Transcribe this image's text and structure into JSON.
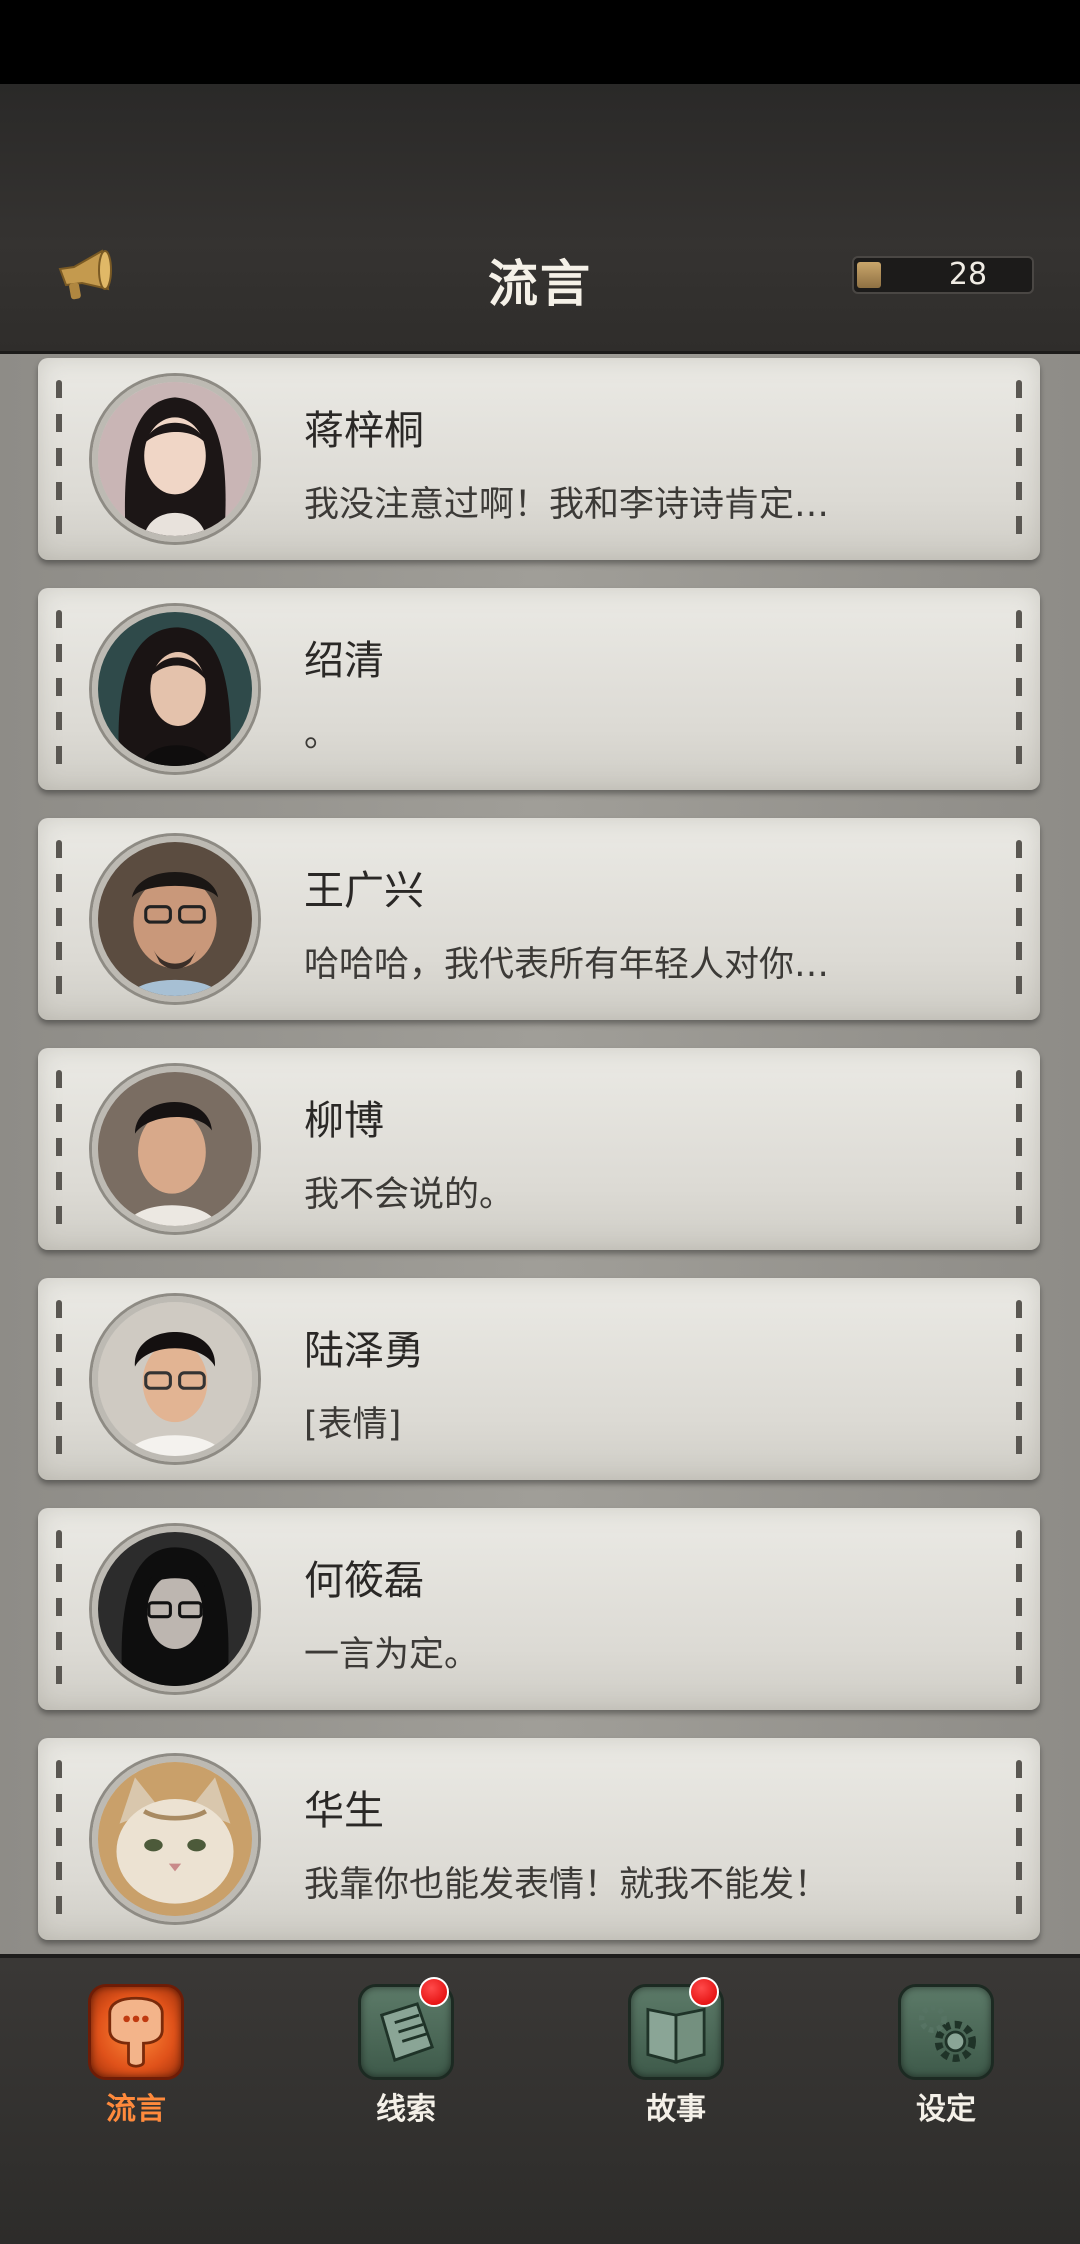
{
  "header": {
    "title": "流言",
    "counter_value": "28",
    "counter_fill_fraction": 0.14,
    "horn_icon": "megaphone-icon"
  },
  "contacts": [
    {
      "name": "蒋梓桐",
      "message": "我没注意过啊！我和李诗诗肯定…",
      "avatar": "female-long-hair-avatar"
    },
    {
      "name": "绍清",
      "message": "。",
      "avatar": "female-portrait-avatar"
    },
    {
      "name": "王广兴",
      "message": "哈哈哈，我代表所有年轻人对你…",
      "avatar": "male-glasses-beard-avatar"
    },
    {
      "name": "柳博",
      "message": "我不会说的。",
      "avatar": "male-short-hair-avatar"
    },
    {
      "name": "陆泽勇",
      "message": "[表情]",
      "avatar": "male-glasses-avatar"
    },
    {
      "name": "何筱磊",
      "message": "一言为定。",
      "avatar": "male-long-hair-glasses-avatar"
    },
    {
      "name": "华生",
      "message": "我靠你也能发表情！就我不能发！",
      "avatar": "cat-avatar"
    }
  ],
  "tabs": [
    {
      "label": "流言",
      "icon": "chat-bubble-icon",
      "active": true,
      "badge": false
    },
    {
      "label": "线索",
      "icon": "notes-icon",
      "active": false,
      "badge": true
    },
    {
      "label": "故事",
      "icon": "book-icon",
      "active": false,
      "badge": true
    },
    {
      "label": "设定",
      "icon": "gear-icon",
      "active": false,
      "badge": false
    }
  ],
  "colors": {
    "active_tab": "#ff8a3c",
    "badge": "#e00000",
    "card_bg": "#e4e3de"
  }
}
